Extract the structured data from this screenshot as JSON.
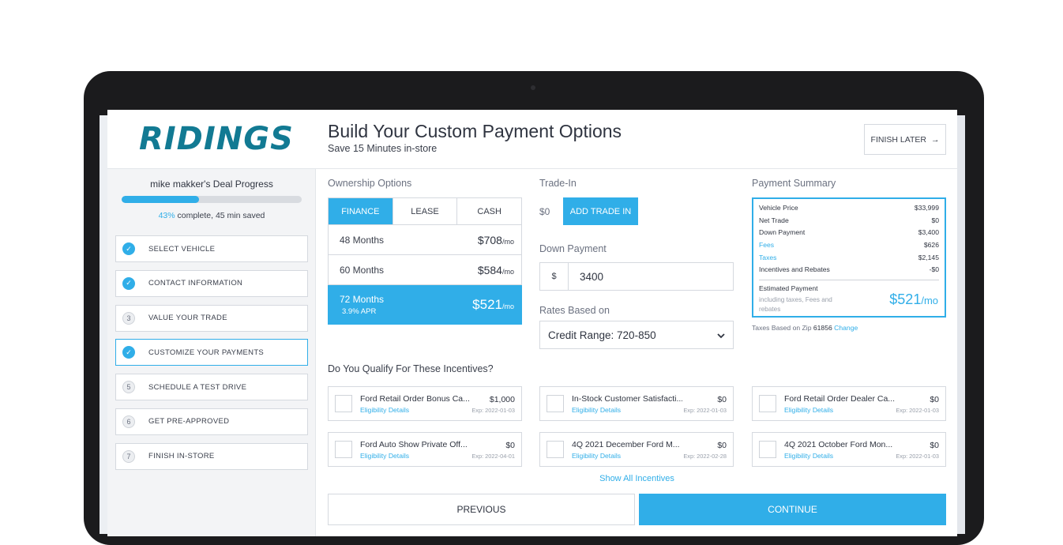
{
  "brand": {
    "logo_text": "RIDINGS",
    "accent": "#30aee8",
    "logo_color": "#127a93"
  },
  "header": {
    "title": "Build Your Custom Payment Options",
    "subtitle": "Save 15 Minutes in-store",
    "finish_later_label": "FINISH LATER",
    "finish_later_icon": "arrow-right-icon"
  },
  "sidebar": {
    "progress_title": "mike makker's Deal Progress",
    "progress_fraction": 0.43,
    "progress_pct": "43%",
    "progress_rest": " complete, 45 min saved",
    "steps": [
      {
        "marker": "✓",
        "label": "SELECT VEHICLE",
        "status": "done"
      },
      {
        "marker": "✓",
        "label": "CONTACT INFORMATION",
        "status": "done"
      },
      {
        "marker": "3",
        "label": "VALUE YOUR TRADE",
        "status": "todo"
      },
      {
        "marker": "✓",
        "label": "CUSTOMIZE YOUR PAYMENTS",
        "status": "active"
      },
      {
        "marker": "5",
        "label": "SCHEDULE A TEST DRIVE",
        "status": "todo"
      },
      {
        "marker": "6",
        "label": "GET PRE-APPROVED",
        "status": "todo"
      },
      {
        "marker": "7",
        "label": "FINISH IN-STORE",
        "status": "todo"
      }
    ]
  },
  "ownership": {
    "label": "Ownership Options",
    "tabs": [
      "FINANCE",
      "LEASE",
      "CASH"
    ],
    "active_tab": "FINANCE",
    "terms": [
      {
        "months": "48 Months",
        "price": "$708",
        "per": "/mo"
      },
      {
        "months": "60 Months",
        "price": "$584",
        "per": "/mo"
      },
      {
        "months": "72 Months",
        "price": "$521",
        "per": "/mo",
        "apr": "3.9% APR",
        "selected": true
      }
    ]
  },
  "trade_in": {
    "label": "Trade-In",
    "value": "$0",
    "button_label": "ADD TRADE IN"
  },
  "down_payment": {
    "label": "Down Payment",
    "prefix": "$",
    "value": "3400"
  },
  "rates": {
    "label": "Rates Based on",
    "selected": "Credit Range: 720-850",
    "chevron": "chevron-down-icon"
  },
  "summary": {
    "label": "Payment Summary",
    "rows": [
      {
        "k": "Vehicle Price",
        "v": "$33,999"
      },
      {
        "k": "Net Trade",
        "v": "$0"
      },
      {
        "k": "Down Payment",
        "v": "$3,400"
      },
      {
        "k": "Fees",
        "v": "$626",
        "link": true
      },
      {
        "k": "Taxes",
        "v": "$2,145",
        "link": true
      },
      {
        "k": "Incentives and Rebates",
        "v": "-$0"
      }
    ],
    "estimated_label": "Estimated Payment",
    "estimated_note": "including taxes, Fees and rebates",
    "estimated_value": "$521",
    "estimated_per": "/mo",
    "zip_prefix": "Taxes Based on Zip ",
    "zip": "61856",
    "change_label": "Change"
  },
  "incentives": {
    "label": "Do You Qualify For These Incentives?",
    "link_label": "Eligibility Details",
    "items": [
      {
        "name": "Ford Retail Order Bonus Ca...",
        "amount": "$1,000",
        "exp": "Exp: 2022-01-03"
      },
      {
        "name": "In-Stock Customer Satisfacti...",
        "amount": "$0",
        "exp": "Exp: 2022-01-03"
      },
      {
        "name": "Ford Retail Order Dealer Ca...",
        "amount": "$0",
        "exp": "Exp: 2022-01-03"
      },
      {
        "name": "Ford Auto Show Private Off...",
        "amount": "$0",
        "exp": "Exp: 2022-04-01"
      },
      {
        "name": "4Q 2021 December Ford M...",
        "amount": "$0",
        "exp": "Exp: 2022-02-28"
      },
      {
        "name": "4Q 2021 October Ford Mon...",
        "amount": "$0",
        "exp": "Exp: 2022-01-03"
      }
    ],
    "show_all_label": "Show All Incentives"
  },
  "footer": {
    "previous_label": "PREVIOUS",
    "continue_label": "CONTINUE"
  }
}
